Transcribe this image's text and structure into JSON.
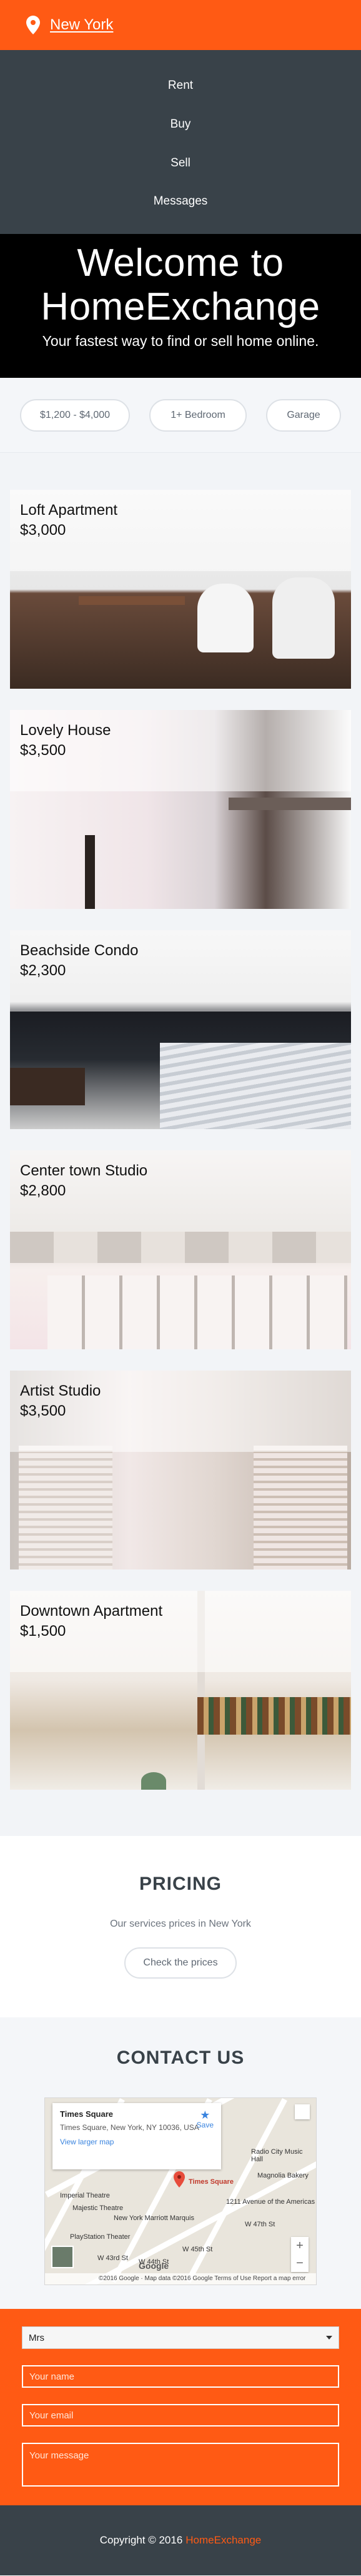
{
  "header": {
    "city": "New York",
    "icon": "map-pin-icon",
    "accent": "#ff5a14"
  },
  "nav": {
    "items": [
      "Rent",
      "Buy",
      "Sell",
      "Messages"
    ]
  },
  "hero": {
    "title_line1": "Welcome to",
    "title_line2": "HomeExchange",
    "subtitle": "Your fastest way to find or sell home online."
  },
  "filters": [
    "$1,200 - $4,000",
    "1+ Bedroom",
    "Garage"
  ],
  "listings": [
    {
      "title": "Loft Apartment",
      "price": "$3,000"
    },
    {
      "title": "Lovely House",
      "price": "$3,500"
    },
    {
      "title": "Beachside Condo",
      "price": "$2,300"
    },
    {
      "title": "Center town Studio",
      "price": "$2,800"
    },
    {
      "title": "Artist Studio",
      "price": "$3,500"
    },
    {
      "title": "Downtown Apartment",
      "price": "$1,500"
    }
  ],
  "pricing": {
    "title": "PRICING",
    "text": "Our services prices in New York",
    "button": "Check the prices"
  },
  "contact": {
    "title": "CONTACT US",
    "map": {
      "place": "Times Square",
      "address": "Times Square, New York, NY 10036, USA",
      "larger_map": "View larger map",
      "save": "Save",
      "marker_label": "Times Square",
      "labels": [
        "Radio City Music Hall",
        "Imperial Theatre",
        "Majestic Theatre",
        "New York Marriott Marquis",
        "PlayStation Theater",
        "1211 Avenue of the Americas",
        "Magnolia Bakery",
        "W 47th St",
        "W 45th St",
        "W 44th St",
        "W 43rd St"
      ],
      "footer": "©2016 Google · Map data ©2016 Google  Terms of Use  Report a map error",
      "logo": "Google"
    },
    "form": {
      "select_value": "Mrs",
      "name_placeholder": "Your name",
      "email_placeholder": "Your email",
      "message_placeholder": "Your message"
    }
  },
  "footer": {
    "copyright": "Copyright © 2016",
    "brand": "HomeExchange"
  }
}
